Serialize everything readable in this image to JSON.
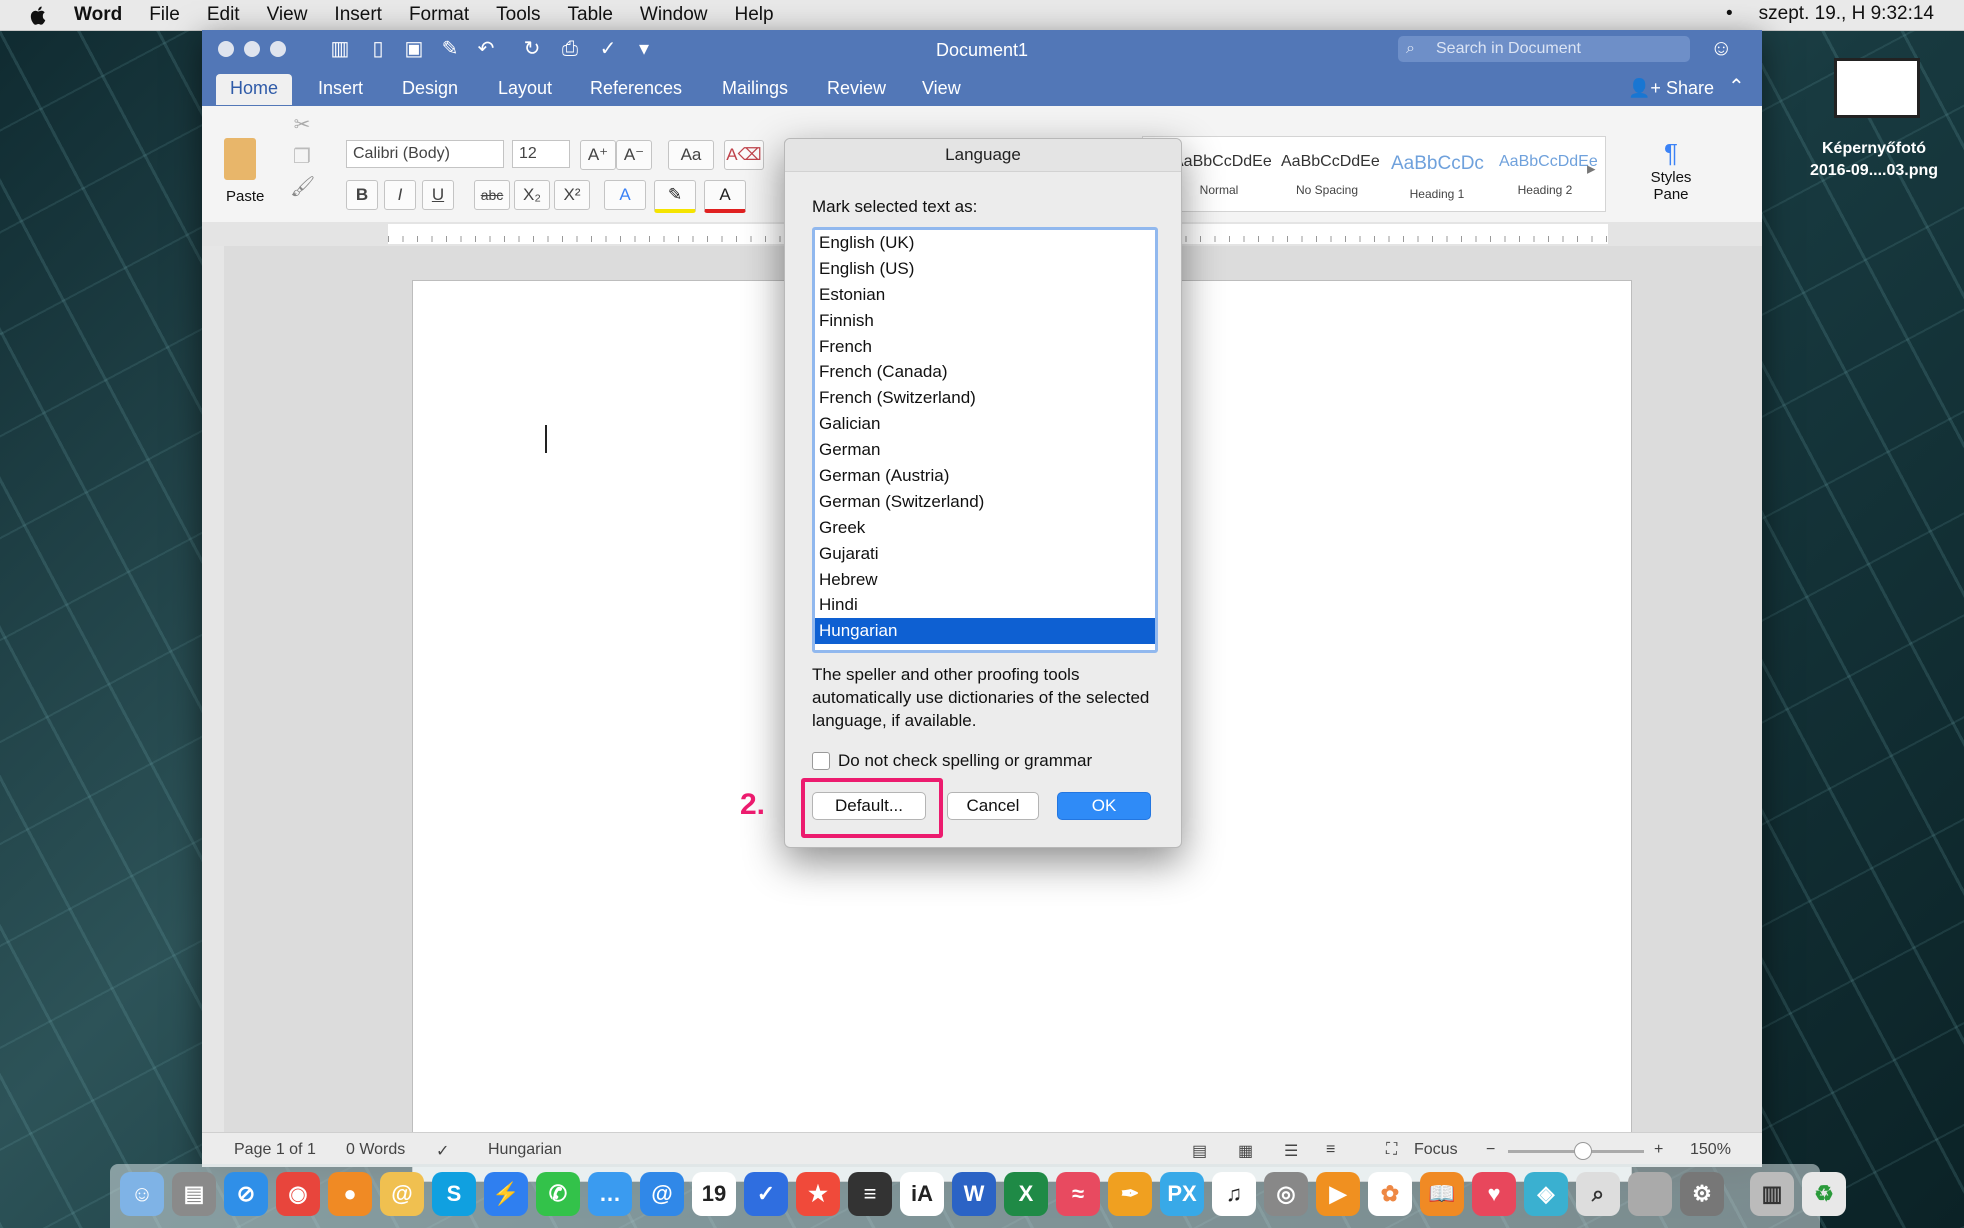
{
  "menubar": {
    "app": "Word",
    "items": [
      "File",
      "Edit",
      "View",
      "Insert",
      "Format",
      "Tools",
      "Table",
      "Window",
      "Help"
    ],
    "clock": "szept. 19., H  9:32:14",
    "dot": "•"
  },
  "window": {
    "title": "Document1",
    "search_placeholder": "Search in Document",
    "share_label": "Share",
    "tabs": [
      "Home",
      "Insert",
      "Design",
      "Layout",
      "References",
      "Mailings",
      "Review",
      "View"
    ]
  },
  "ribbon": {
    "paste_label": "Paste",
    "font_name": "Calibri (Body)",
    "font_size": "12",
    "styles": [
      {
        "sample": "AaBbCcDdEe",
        "name": "Normal"
      },
      {
        "sample": "AaBbCcDdEe",
        "name": "No Spacing"
      },
      {
        "sample": "AaBbCcDc",
        "name": "Heading 1"
      },
      {
        "sample": "AaBbCcDdEe",
        "name": "Heading 2"
      }
    ],
    "styles_pane": "Styles Pane"
  },
  "status": {
    "page": "Page 1 of 1",
    "words": "0 Words",
    "language": "Hungarian",
    "focus": "Focus",
    "zoom": "150%"
  },
  "dialog": {
    "title": "Language",
    "prompt": "Mark selected text as:",
    "languages": [
      "English (UK)",
      "English (US)",
      "Estonian",
      "Finnish",
      "French",
      "French (Canada)",
      "French (Switzerland)",
      "Galician",
      "German",
      "German (Austria)",
      "German (Switzerland)",
      "Greek",
      "Gujarati",
      "Hebrew",
      "Hindi",
      "Hungarian"
    ],
    "selected": "Hungarian",
    "help": "The speller and other proofing tools automatically use dictionaries of the selected language, if available.",
    "checkbox_label": "Do not check spelling or grammar",
    "default_btn": "Default...",
    "cancel_btn": "Cancel",
    "ok_btn": "OK"
  },
  "annotation": {
    "step": "2.",
    "color": "#ec1b6e"
  },
  "desktop_icon": {
    "label_line1": "Képernyőfotó",
    "label_line2": "2016-09....03.png"
  }
}
